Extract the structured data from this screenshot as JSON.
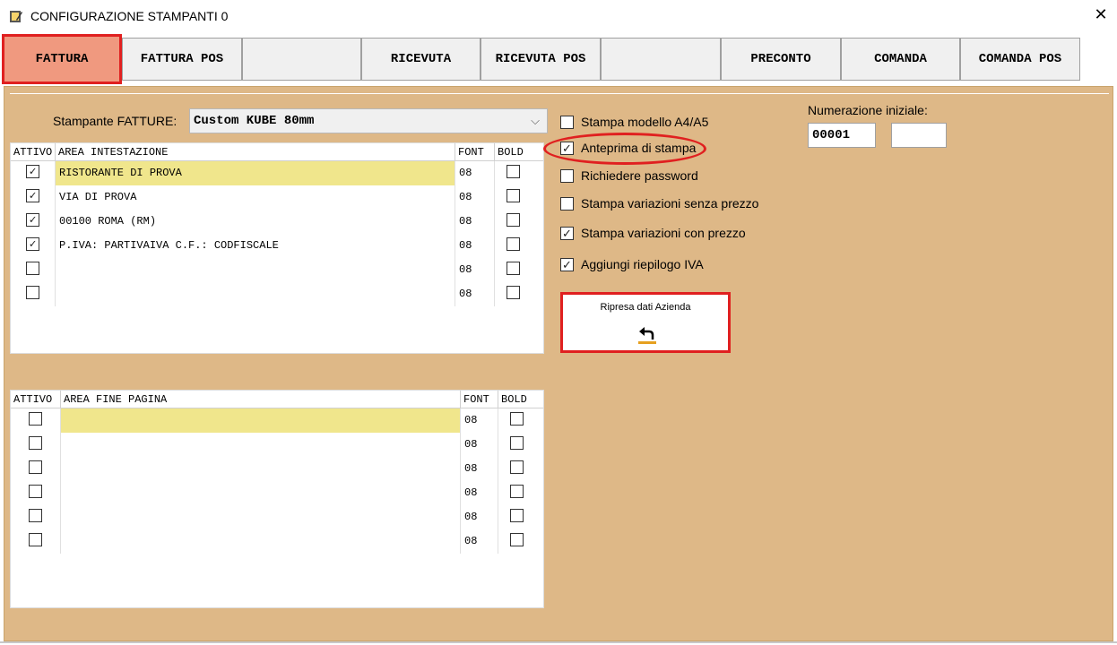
{
  "window": {
    "title": "CONFIGURAZIONE STAMPANTI 0",
    "icon": "printer-config-icon",
    "close_icon": "close-icon"
  },
  "tabs": [
    {
      "label": "FATTURA",
      "active": true
    },
    {
      "label": "FATTURA POS"
    },
    {
      "label": ""
    },
    {
      "label": "RICEVUTA"
    },
    {
      "label": "RICEVUTA POS"
    },
    {
      "label": ""
    },
    {
      "label": "PRECONTO"
    },
    {
      "label": "COMANDA"
    },
    {
      "label": "COMANDA POS"
    }
  ],
  "printer": {
    "label": "Stampante FATTURE:",
    "selected": "Custom KUBE 80mm"
  },
  "header_grid": {
    "columns": [
      "ATTIVO",
      "AREA INTESTAZIONE",
      "FONT",
      "BOLD"
    ],
    "rows": [
      {
        "active": true,
        "text": "RISTORANTE DI PROVA",
        "font": "08",
        "bold": false
      },
      {
        "active": true,
        "text": "VIA DI PROVA",
        "font": "08",
        "bold": false
      },
      {
        "active": true,
        "text": "00100 ROMA (RM)",
        "font": "08",
        "bold": false
      },
      {
        "active": true,
        "text": "P.IVA: PARTIVAIVA   C.F.: CODFISCALE",
        "font": "08",
        "bold": false
      },
      {
        "active": false,
        "text": "",
        "font": "08",
        "bold": false
      },
      {
        "active": false,
        "text": "",
        "font": "08",
        "bold": false
      }
    ]
  },
  "footer_grid": {
    "columns": [
      "ATTIVO",
      "AREA FINE PAGINA",
      "FONT",
      "BOLD"
    ],
    "rows": [
      {
        "active": false,
        "text": "",
        "font": "08",
        "bold": false
      },
      {
        "active": false,
        "text": "",
        "font": "08",
        "bold": false
      },
      {
        "active": false,
        "text": "",
        "font": "08",
        "bold": false
      },
      {
        "active": false,
        "text": "",
        "font": "08",
        "bold": false
      },
      {
        "active": false,
        "text": "",
        "font": "08",
        "bold": false
      },
      {
        "active": false,
        "text": "",
        "font": "08",
        "bold": false
      }
    ]
  },
  "options": [
    {
      "label": "Stampa modello A4/A5",
      "checked": false
    },
    {
      "label": "Anteprima di stampa",
      "checked": true
    },
    {
      "label": "Richiedere password",
      "checked": false
    },
    {
      "label": "Stampa variazioni senza prezzo",
      "checked": false
    },
    {
      "label": "Stampa variazioni con prezzo",
      "checked": true
    },
    {
      "label": "Aggiungi riepilogo IVA",
      "checked": true
    }
  ],
  "numerazione": {
    "label": "Numerazione iniziale:",
    "value": "00001",
    "value2": ""
  },
  "ripresa": {
    "label": "Ripresa dati Azienda",
    "icon": "return-arrow-icon"
  },
  "colors": {
    "panel": "#deb887",
    "active_tab": "#f0997f",
    "highlight": "#f0e68c",
    "annotation": "#e02020"
  }
}
